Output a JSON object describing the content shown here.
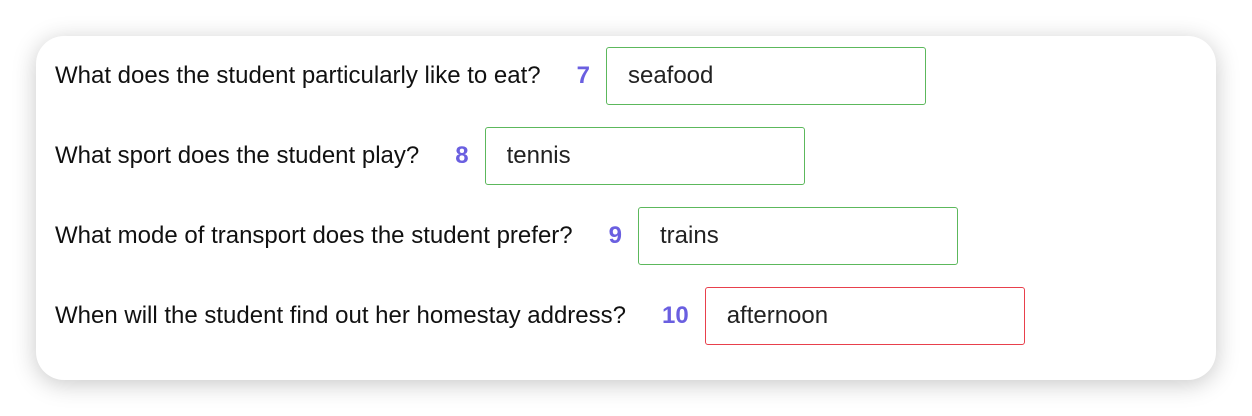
{
  "questions": [
    {
      "text": "What does the student particularly like to eat?",
      "number": "7",
      "answer": "seafood",
      "status": "correct"
    },
    {
      "text": "What sport does the student play?",
      "number": "8",
      "answer": "tennis",
      "status": "correct"
    },
    {
      "text": "What mode of transport does the student prefer?",
      "number": "9",
      "answer": "trains",
      "status": "correct"
    },
    {
      "text": "When will the student find out her homestay address?",
      "number": "10",
      "answer": "afternoon",
      "status": "incorrect"
    }
  ],
  "colors": {
    "correct": "#5cb85c",
    "incorrect": "#e8404c",
    "number": "#6a5fe0"
  }
}
